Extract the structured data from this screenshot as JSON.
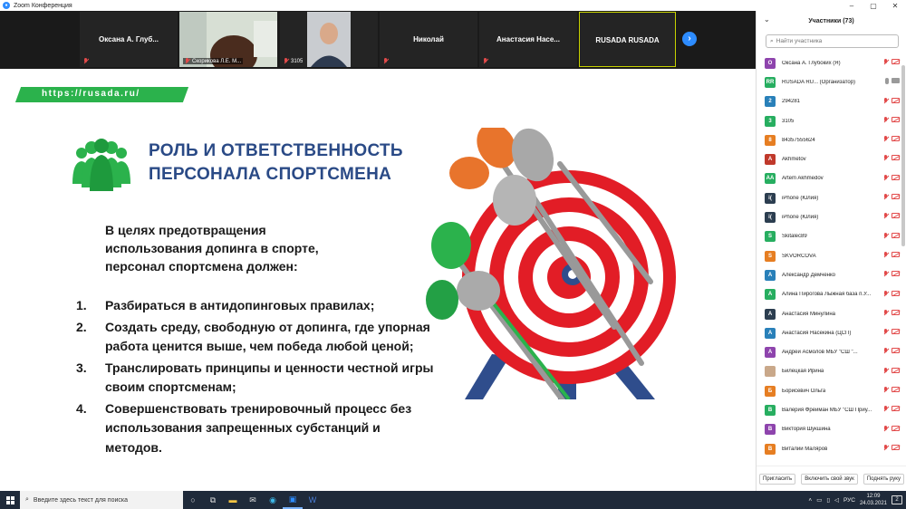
{
  "window": {
    "title": "Zoom Конференция"
  },
  "strip": {
    "tiles": [
      {
        "name": "Оксана А. Глуб...",
        "label": ""
      },
      {
        "name": "",
        "label": "Скорикова Л.Е. М..."
      },
      {
        "name": "",
        "label": "3105"
      },
      {
        "name": "Николай",
        "label": ""
      },
      {
        "name": "Анастасия Насе...",
        "label": ""
      },
      {
        "name": "RUSADA RUSADA",
        "label": ""
      }
    ],
    "next_icon": "chevron-right-icon"
  },
  "slide": {
    "url": "https://rusada.ru/",
    "title_line1": "РОЛЬ И ОТВЕТСТВЕННОСТЬ",
    "title_line2": "ПЕРСОНАЛА СПОРТСМЕНА",
    "intro_line1": "В целях предотвращения",
    "intro_line2": "использования допинга в спорте,",
    "intro_line3": "персонал спортсмена должен:",
    "items": [
      {
        "num": "1.",
        "text": "Разбираться в антидопинговых правилах;"
      },
      {
        "num": "2.",
        "text": "Создать среду, свободную от допинга, где упорная работа ценится выше, чем победа любой ценой;"
      },
      {
        "num": "3.",
        "text": "Транслировать принципы и ценности честной игры своим спортсменам;"
      },
      {
        "num": "4.",
        "text": "Совершенствовать тренировочный процесс без использования запрещенных субстанций и методов."
      }
    ],
    "colors": {
      "green": "#2bb24c",
      "title_blue": "#2a4a86",
      "target_red": "#e21d26"
    }
  },
  "participants": {
    "header": "Участники (73)",
    "search_placeholder": "Найти участника",
    "list": [
      {
        "initials": "О",
        "color": "#8e44ad",
        "name": "Оксана А. Глубоких (Я)"
      },
      {
        "initials": "RR",
        "color": "#27ae60",
        "name": "RUSADA RU... (Организатор)"
      },
      {
        "initials": "2",
        "color": "#2980b9",
        "name": "294281"
      },
      {
        "initials": "3",
        "color": "#27ae60",
        "name": "3105"
      },
      {
        "initials": "8",
        "color": "#e67e22",
        "name": "84357555624"
      },
      {
        "initials": "A",
        "color": "#c0392b",
        "name": "Akhmetov"
      },
      {
        "initials": "AA",
        "color": "#27ae60",
        "name": "Artem Akhmedov"
      },
      {
        "initials": "i(",
        "color": "#2c3e50",
        "name": "iPhone (Юлия)"
      },
      {
        "initials": "i(",
        "color": "#2c3e50",
        "name": "iPhone (Юлия)"
      },
      {
        "initials": "S",
        "color": "#27ae60",
        "name": "Skitalec89"
      },
      {
        "initials": "S",
        "color": "#e67e22",
        "name": "SKVORCOVA"
      },
      {
        "initials": "А",
        "color": "#2980b9",
        "name": "Александр Демченко"
      },
      {
        "initials": "А",
        "color": "#27ae60",
        "name": "Алина Пирогова Лыжная база п.У..."
      },
      {
        "initials": "А",
        "color": "#2c3e50",
        "name": "Анастасия Минулина"
      },
      {
        "initials": "А",
        "color": "#2980b9",
        "name": "Анастасия Насекина (ЦСП)"
      },
      {
        "initials": "А",
        "color": "#8e44ad",
        "name": "Андрей Асмолов МБУ \"СШ \"..."
      },
      {
        "initials": "",
        "color": "#c9a88a",
        "name": "Билецкая Ирина"
      },
      {
        "initials": "Б",
        "color": "#e67e22",
        "name": "Борисевич Ольга"
      },
      {
        "initials": "В",
        "color": "#27ae60",
        "name": "Валерия Фрейман МБУ \"СШ Приу..."
      },
      {
        "initials": "В",
        "color": "#8e44ad",
        "name": "Виктория Шукшина"
      },
      {
        "initials": "В",
        "color": "#e67e22",
        "name": "Виталий Маляров"
      }
    ],
    "buttons": {
      "invite": "Пригласить",
      "unmute": "Включить свой звук",
      "raise": "Поднять руку"
    }
  },
  "taskbar": {
    "search_placeholder": "Введите здесь текст для поиска",
    "lang": "РУС",
    "time": "12:09",
    "date": "24.03.2021",
    "notifications": "2"
  }
}
